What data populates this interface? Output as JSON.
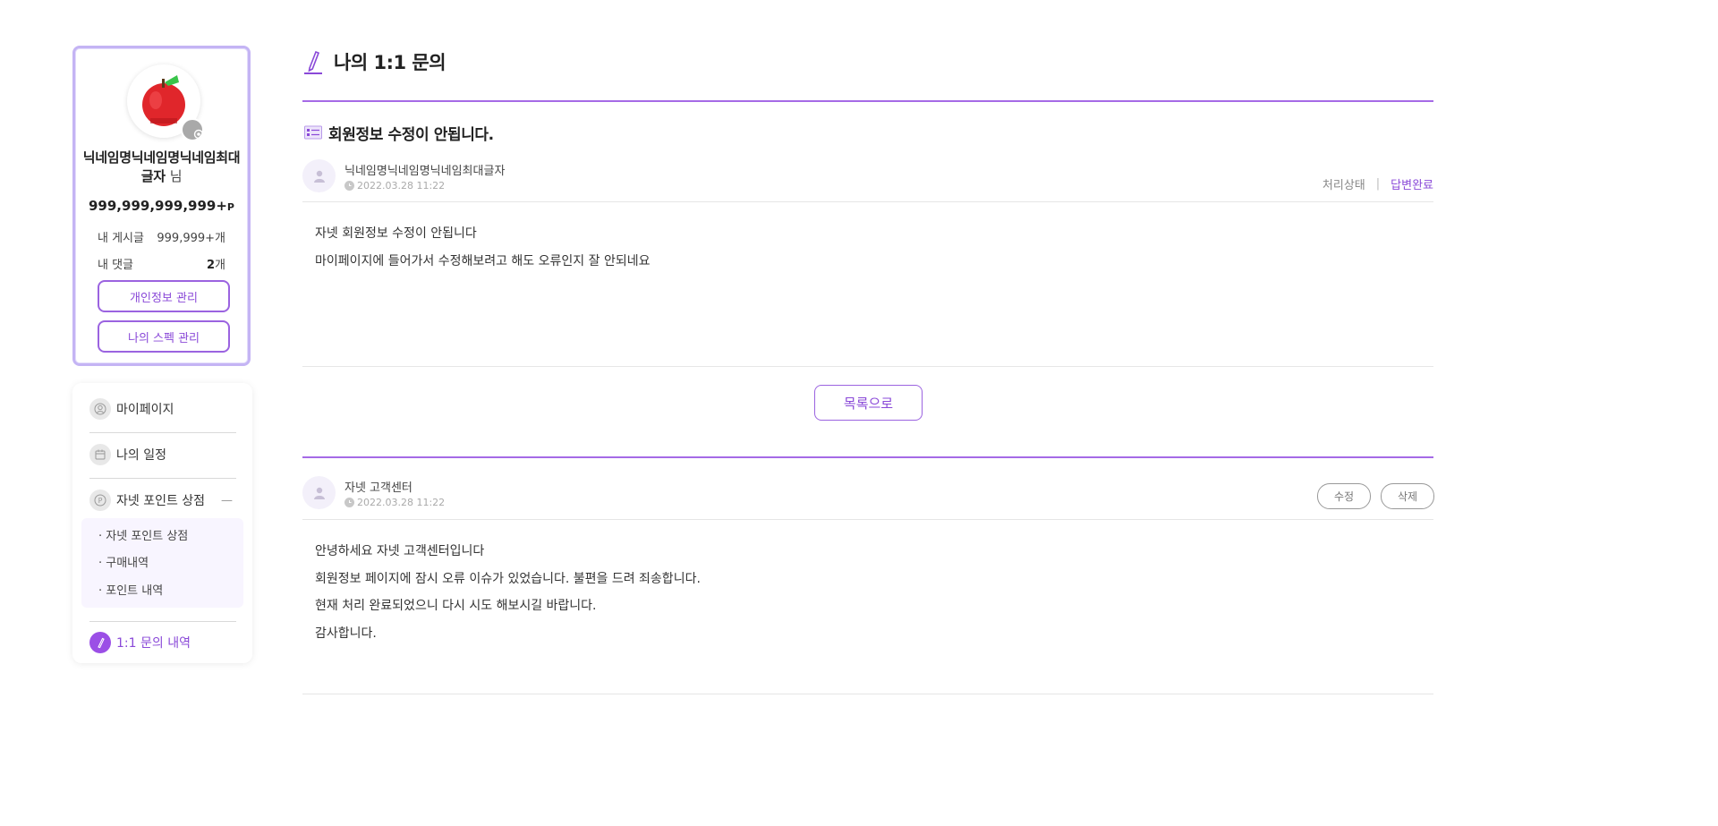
{
  "profile": {
    "nickname": "닉네임명닉네임명닉네임최대글자",
    "nickname_suffix": "님",
    "points": "999,999,999,999+",
    "points_unit": "P",
    "posts_label": "내 게시글",
    "posts_value": "999,999+",
    "posts_unit": "개",
    "comments_label": "내 댓글",
    "comments_value": "2",
    "comments_unit": "개",
    "btn_profile": "개인정보 관리",
    "btn_spec": "나의 스펙 관리"
  },
  "menu": {
    "mypage": "마이페이지",
    "schedule": "나의 일정",
    "point_shop": "자넷 포인트 상점",
    "collapse": "—",
    "sub": [
      "· 자넷 포인트 상점",
      "· 구매내역",
      "· 포인트 내역"
    ],
    "inquiry": "1:1 문의 내역"
  },
  "page": {
    "title": "나의 1:1 문의"
  },
  "question": {
    "title": "회원정보 수정이 안됩니다.",
    "author": "닉네임명닉네임명닉네임최대글자",
    "date": "2022.03.28 11:22",
    "status_label": "처리상태",
    "status_sep": "|",
    "status_value": "답변완료",
    "lines": [
      "자넷 회원정보 수정이 안됩니다",
      "마이페이지에 들어가서 수정해보려고 해도 오류인지 잘 안되네요"
    ]
  },
  "list_button": "목록으로",
  "answer": {
    "author": "자넷 고객센터",
    "date": "2022.03.28 11:22",
    "edit": "수정",
    "delete": "삭제",
    "lines": [
      "안녕하세요 자넷 고객센터입니다",
      "회원정보 페이지에 잠시 오류 이슈가 있었습니다. 불편을 드려 죄송합니다.",
      "현재 처리 완료되었으니 다시 시도 해보시길 바랍니다.",
      "감사합니다."
    ]
  },
  "icons": {
    "avatar": "apple-avatar",
    "camera": "camera-icon",
    "user": "user-icon",
    "calendar": "calendar-icon",
    "point": "point-icon",
    "pencil": "pencil-icon",
    "clock": "clock-icon",
    "list": "list-icon"
  },
  "colors": {
    "accent": "#8a49d8",
    "border_light": "#c4b4f4"
  }
}
